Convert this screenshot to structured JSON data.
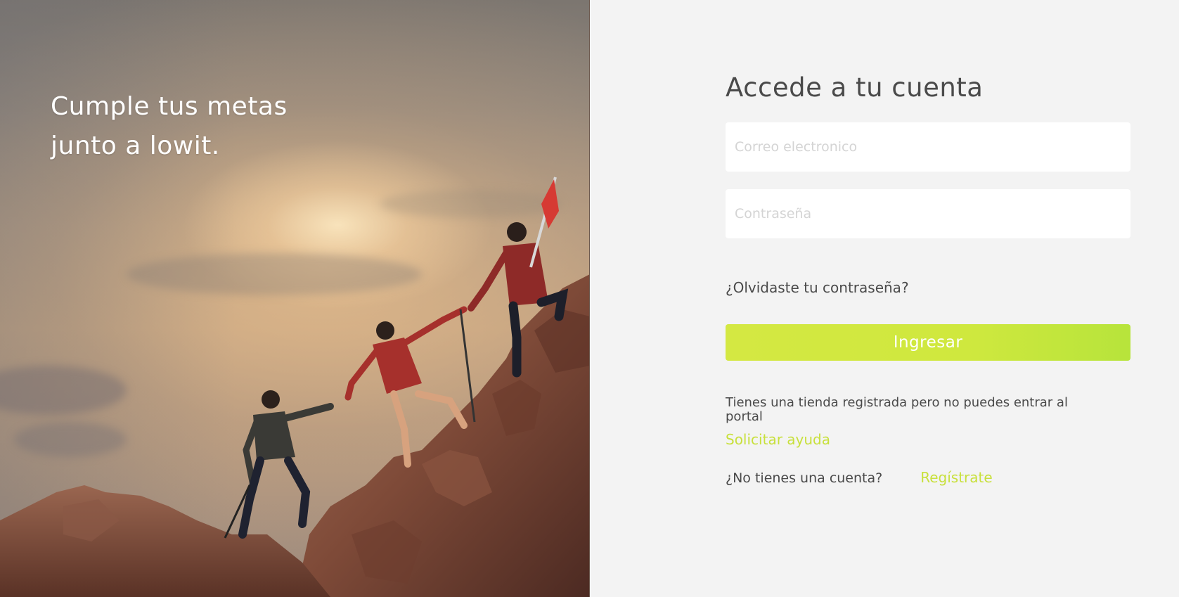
{
  "hero": {
    "tagline_line1": "Cumple tus metas",
    "tagline_line2": "junto a lowit.",
    "image_subject": "hikers-helping-climb-mountain-photo",
    "flag_color": "#d63a33"
  },
  "login": {
    "title": "Accede a tu cuenta",
    "email": {
      "placeholder": "Correo electronico",
      "value": ""
    },
    "password": {
      "placeholder": "Contraseña",
      "value": ""
    },
    "forgot_password": "¿Olvidaste tu contraseña?",
    "submit_label": "Ingresar",
    "store_help_text": "Tienes una tienda registrada pero no puedes entrar al portal",
    "store_help_link": "Solicitar ayuda",
    "signup_question": "¿No tienes una cuenta?",
    "signup_link": "Regístrate"
  },
  "colors": {
    "accent": "#cde63f",
    "accent_end": "#b2e33c",
    "panel_background": "#f3f3f3",
    "text": "#4a4a4a",
    "input_background": "#ffffff",
    "placeholder": "#d4d4d4"
  }
}
